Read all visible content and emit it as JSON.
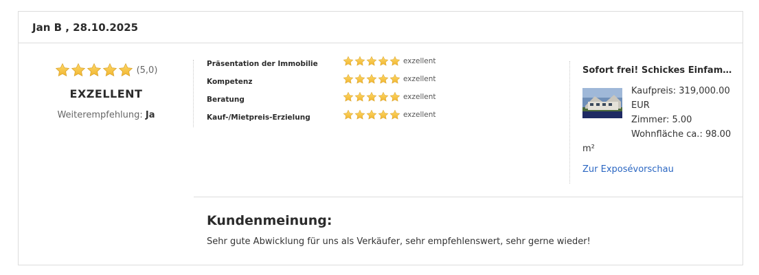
{
  "review": {
    "header": "Jan B , 28.10.2025",
    "overall": {
      "stars": 5,
      "score_text": "(5,0)",
      "level": "EXZELLENT",
      "recommendation_label": "Weiterempfehlung:",
      "recommendation_value": "Ja"
    },
    "criteria": [
      {
        "label": "Präsentation der Immobilie",
        "stars": 5,
        "text": "exzellent"
      },
      {
        "label": "Kompetenz",
        "stars": 5,
        "text": "exzellent"
      },
      {
        "label": "Beratung",
        "stars": 5,
        "text": "exzellent"
      },
      {
        "label": "Kauf-/Mietpreis-Erzielung",
        "stars": 5,
        "text": "exzellent"
      }
    ],
    "listing": {
      "title": "Sofort frei! Schickes Einfamilien...",
      "price_line1": "Kaufpreis: 319,000.00",
      "price_line2": "EUR",
      "rooms": "Zimmer: 5.00",
      "area_line1": "Wohnfläche ca.: 98.00",
      "area_line2": "m²",
      "link": "Zur Exposévorschau"
    },
    "opinion": {
      "title": "Kundenmeinung:",
      "text": "Sehr gute Abwicklung für uns als Verkäufer, sehr empfehlenswert, sehr gerne wieder!"
    }
  },
  "colors": {
    "star": "#f5c242",
    "link": "#2a66c2",
    "border": "#dcdcdc"
  }
}
